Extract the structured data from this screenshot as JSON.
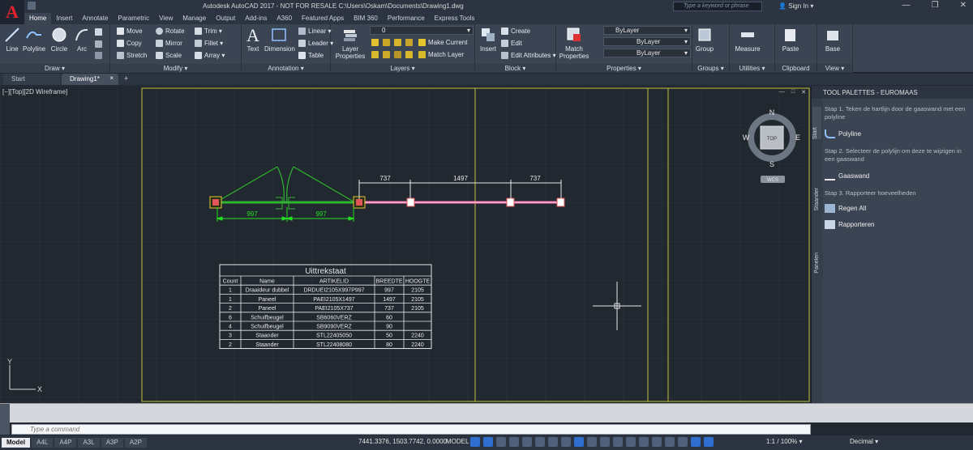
{
  "app": {
    "title": "Autodesk AutoCAD 2017 - NOT FOR RESALE    C:\\Users\\Oskam\\Documents\\Drawing1.dwg",
    "search_placeholder": "Type a keyword or phrase",
    "sign_in": "Sign In",
    "logo_letter": "A"
  },
  "ribbon_tabs": [
    "Home",
    "Insert",
    "Annotate",
    "Parametric",
    "View",
    "Manage",
    "Output",
    "Add-ins",
    "A360",
    "Featured Apps",
    "BIM 360",
    "Performance",
    "Express Tools"
  ],
  "ribbon": {
    "draw": {
      "title": "Draw ▾",
      "line": "Line",
      "polyline": "Polyline",
      "circle": "Circle",
      "arc": "Arc"
    },
    "modify": {
      "title": "Modify ▾",
      "move": "Move",
      "rotate": "Rotate",
      "trim": "Trim ▾",
      "copy": "Copy",
      "mirror": "Mirror",
      "fillet": "Fillet ▾",
      "stretch": "Stretch",
      "scale": "Scale",
      "array": "Array ▾"
    },
    "annotation": {
      "title": "Annotation ▾",
      "text": "Text",
      "dimension": "Dimension",
      "linear": "Linear ▾",
      "leader": "Leader ▾",
      "table": "Table"
    },
    "layers": {
      "title": "Layers ▾",
      "layer_properties_1": "Layer",
      "layer_properties_2": "Properties",
      "layer_value": "0",
      "make_current": "Make Current",
      "match_layer": "Match Layer"
    },
    "block": {
      "title": "Block ▾",
      "insert": "Insert",
      "create": "Create",
      "edit": "Edit",
      "edit_attributes": "Edit Attributes ▾"
    },
    "properties": {
      "title": "Properties ▾",
      "match_1": "Match",
      "match_2": "Properties",
      "bylayer1": "ByLayer",
      "bylayer2": "ByLayer",
      "bylayer3": "ByLayer"
    },
    "groups": {
      "title": "Groups ▾",
      "group": "Group"
    },
    "utilities": {
      "title": "Utilities ▾",
      "measure": "Measure"
    },
    "clipboard": {
      "title": "Clipboard",
      "paste": "Paste"
    },
    "view": {
      "title": "View ▾",
      "base": "Base"
    }
  },
  "doc_tabs": {
    "start": "Start",
    "drawing": "Drawing1*",
    "plus": "+"
  },
  "viewport": {
    "label": "[−][Top][2D Wireframe]",
    "compass": {
      "n": "N",
      "s": "S",
      "e": "E",
      "w": "W",
      "top": "TOP",
      "wcs": "WCS"
    },
    "ucs": {
      "x": "X",
      "y": "Y"
    }
  },
  "dimensions": {
    "d1": "997",
    "d2": "997",
    "d3": "737",
    "d4": "1497",
    "d5": "737"
  },
  "table": {
    "title": "Uittrekstaat",
    "headers": [
      "Count",
      "Name",
      "ARTIKELID",
      "BREEDTE",
      "HOOGTE"
    ],
    "rows": [
      [
        "1",
        "Draaideur dubbel",
        "DRDUEI2105X997P997",
        "997",
        "2105"
      ],
      [
        "1",
        "Paneel",
        "PAEI2105X1497",
        "1497",
        "2105"
      ],
      [
        "2",
        "Paneel",
        "PAEI2105X737",
        "737",
        "2105"
      ],
      [
        "6",
        "Schuifbeugel",
        "SB6060VERZ",
        "60",
        ""
      ],
      [
        "4",
        "Schuifbeugel",
        "SB9090VERZ",
        "90",
        ""
      ],
      [
        "3",
        "Staander",
        "STL22405050",
        "50",
        "2240"
      ],
      [
        "2",
        "Staander",
        "STL22408080",
        "80",
        "2240"
      ]
    ]
  },
  "palette": {
    "title": "TOOL PALETTES - EUROMAAS",
    "side_tabs": [
      "Start",
      "Staander",
      "Panelen"
    ],
    "step1": "Stap 1. Teken de hartlijn door de gaaswand met een polyline",
    "tool1": "Polyline",
    "step2": "Stap 2. Selecteer de polylijn om deze te wijzigen in een gaaswand",
    "tool2": "Gaaswand",
    "step3": "Stap 3. Rapporteer hoeveelheden",
    "tool3": "Regen All",
    "tool4": "Rapporteren"
  },
  "command": {
    "placeholder": "Type a command"
  },
  "status": {
    "layouts": [
      "Model",
      "A4L",
      "A4P",
      "A3L",
      "A3P",
      "A2P"
    ],
    "coords": "7441.3376, 1503.7742, 0.0000",
    "model": "MODEL",
    "scale": "1:1 / 100% ▾",
    "units": "Decimal ▾"
  },
  "colors": {
    "ui_dark": "#212830",
    "ribbon": "#3b4453",
    "accent_green": "#22e022",
    "door_line": "#2fb52f",
    "wall": "#ff6fae",
    "frame": "#c2c13a"
  }
}
